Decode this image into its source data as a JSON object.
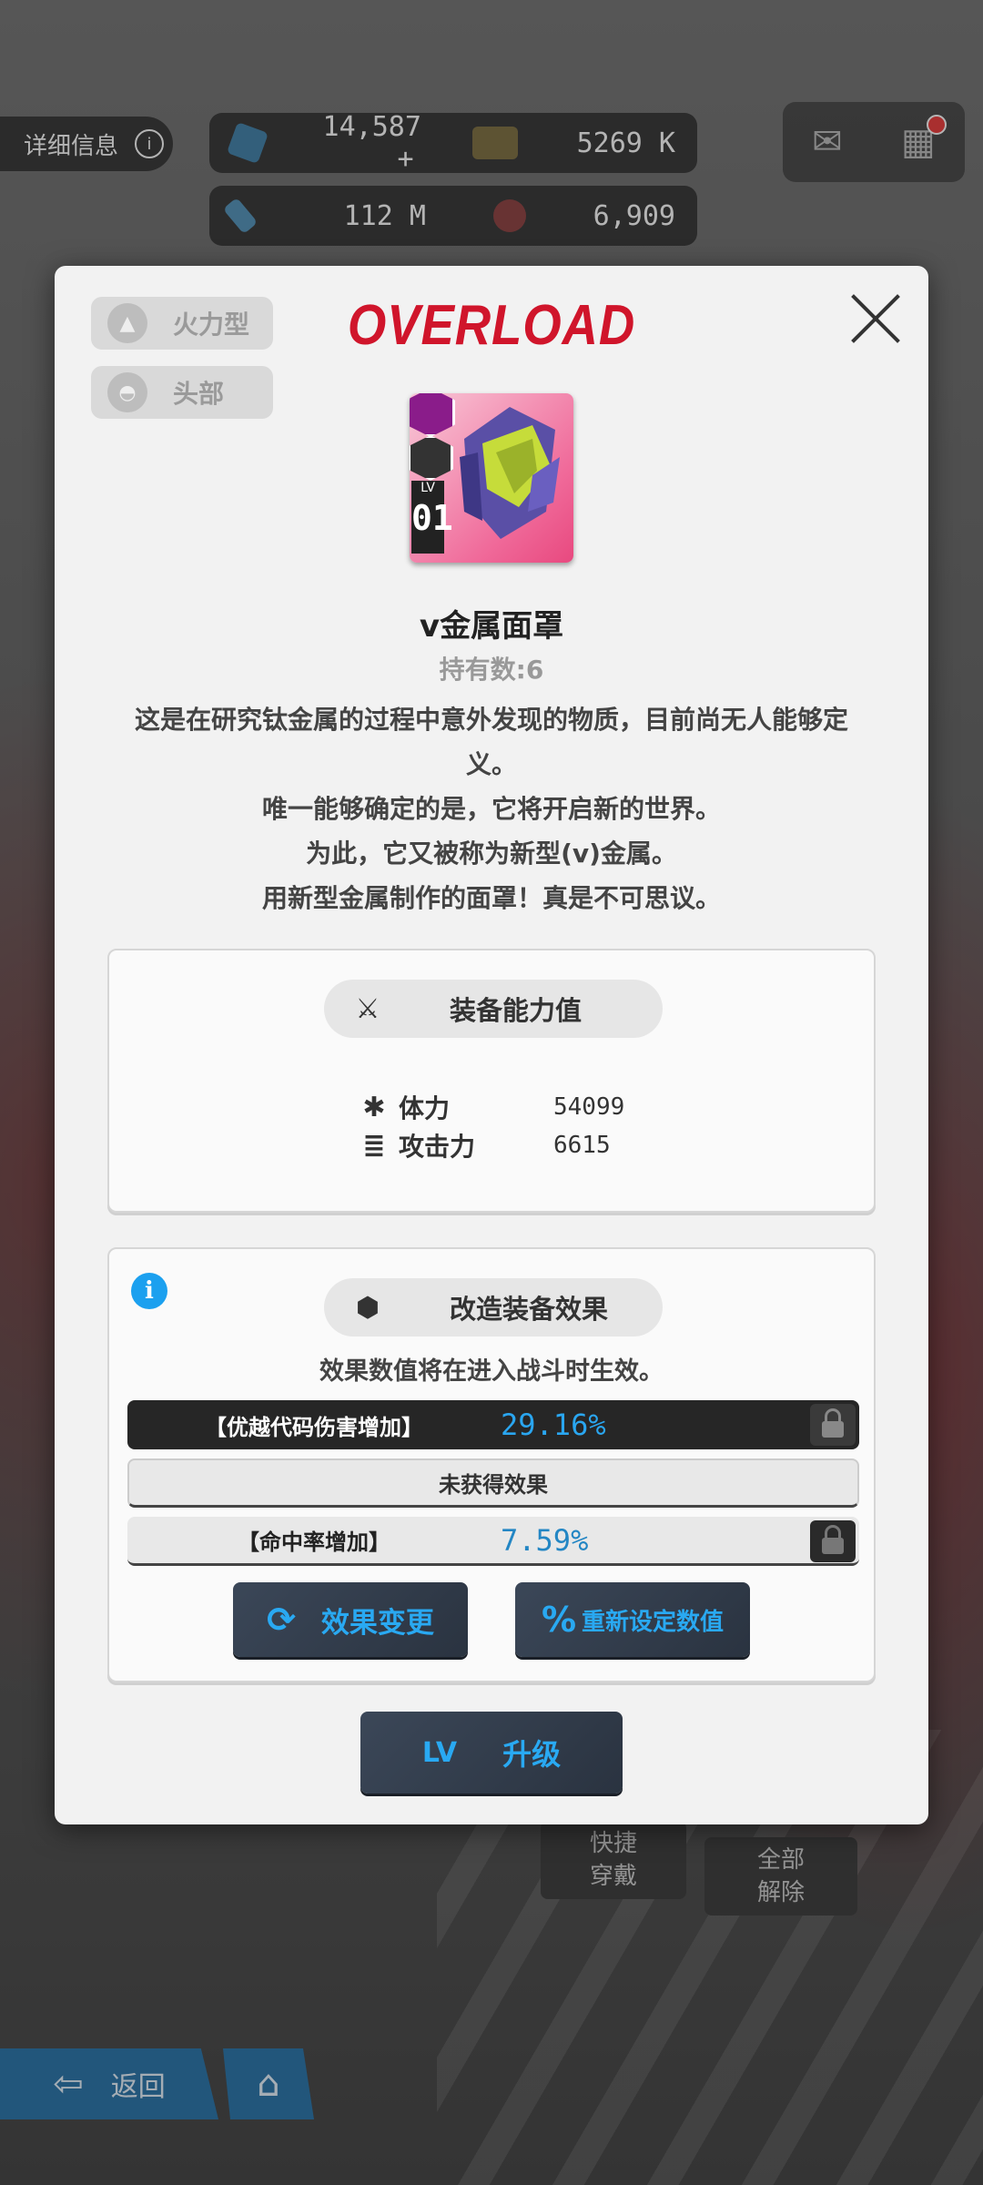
{
  "background": {
    "detail_tab": {
      "label": "详细信息",
      "info_icon": "info-icon"
    },
    "currencies": [
      {
        "icon": "gem-icon",
        "value": "14,587",
        "extra": "+"
      },
      {
        "icon": "credit-card-icon",
        "value": "5269 K"
      },
      {
        "icon": "ammo-icon",
        "value": "112 M"
      },
      {
        "icon": "core-icon",
        "value": "6,909"
      }
    ],
    "mail_icon": "mail-icon",
    "menu_icon": "grid-icon",
    "quick_equip_label": "快捷\n穿戴",
    "unequip_all_label": "全部\n解除",
    "back_label": "返回",
    "home_icon": "home-icon"
  },
  "modal": {
    "type_tag": {
      "icon": "firepower-icon",
      "label": "火力型"
    },
    "slot_tag": {
      "icon": "helmet-icon",
      "label": "头部"
    },
    "header_title": "OVERLOAD",
    "close_icon": "close-icon",
    "item": {
      "name": "v金属面罩",
      "owned": "持有数:6",
      "level_label": "LV",
      "level": "01",
      "rarity_icon": "rarity-badge-icon",
      "class_icon": "class-badge-icon",
      "description": [
        "这是在研究钛金属的过程中意外发现的物质，目前尚无人能够定",
        "义。",
        "唯一能够确定的是，它将开启新的世界。",
        "为此，它又被称为新型(v)金属。",
        "用新型金属制作的面罩！真是不可思议。"
      ]
    },
    "stats_panel": {
      "title": "装备能力值",
      "icon": "crossed-swords-icon",
      "stats": [
        {
          "icon": "asterisk-icon",
          "label": "体力",
          "value": "54099"
        },
        {
          "icon": "bullets-icon",
          "label": "攻击力",
          "value": "6615"
        }
      ]
    },
    "effect_panel": {
      "title": "改造装备效果",
      "icon": "module-icon",
      "info_icon": "info-icon",
      "note": "效果数值将在进入战斗时生效。",
      "effects": [
        {
          "name": "【优越代码伤害增加】",
          "value": "29.16%",
          "style": "dark",
          "lock_icon": "lock-icon"
        },
        {
          "name": "未获得效果",
          "value": "",
          "style": "light"
        },
        {
          "name": "【命中率增加】",
          "value": "7.59%",
          "style": "light",
          "lock_icon": "lock-icon"
        }
      ],
      "change_button": {
        "icon": "refresh-icon",
        "label": "效果变更"
      },
      "reset_button": {
        "icon": "percent-icon",
        "label": "重新设定数值"
      }
    },
    "upgrade_button": {
      "icon_text": "LV",
      "label": "升级"
    }
  }
}
